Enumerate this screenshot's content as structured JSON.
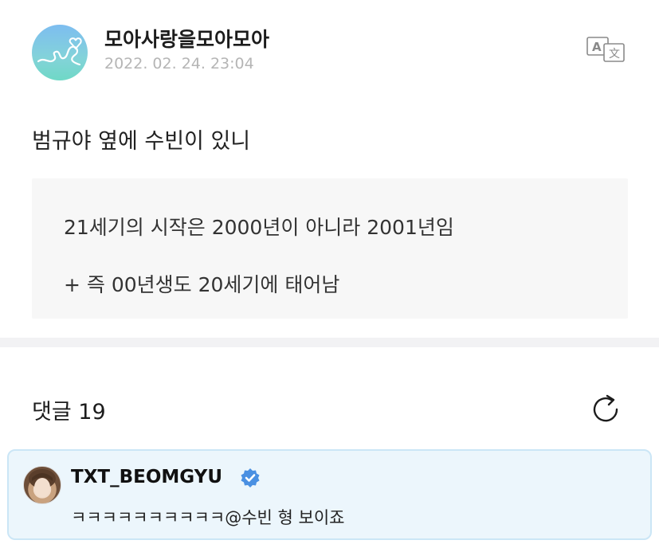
{
  "post": {
    "author": "모아사랑을모아모아",
    "date": "2022. 02. 24. 23:04",
    "body": "범규야 옆에 수빈이 있니",
    "quote_lines": [
      "21세기의 시작은 2000년이 아니라 2001년임",
      "+ 즉 00년생도 20세기에 태어남"
    ]
  },
  "comments": {
    "title": "댓글 19",
    "items": [
      {
        "author": "TXT_BEOMGYU",
        "verified": true,
        "text": "ㅋㅋㅋㅋㅋㅋㅋㅋㅋㅋ@수빈 형 보이죠"
      }
    ]
  },
  "icons": {
    "translate": "translate-icon",
    "refresh": "refresh-icon",
    "verified": "verified-badge-icon"
  },
  "colors": {
    "date_gray": "#b5b5b5",
    "comment_bg": "#ecf6fc",
    "comment_border": "#cbe6f6",
    "verified_blue": "#4a90e2"
  }
}
